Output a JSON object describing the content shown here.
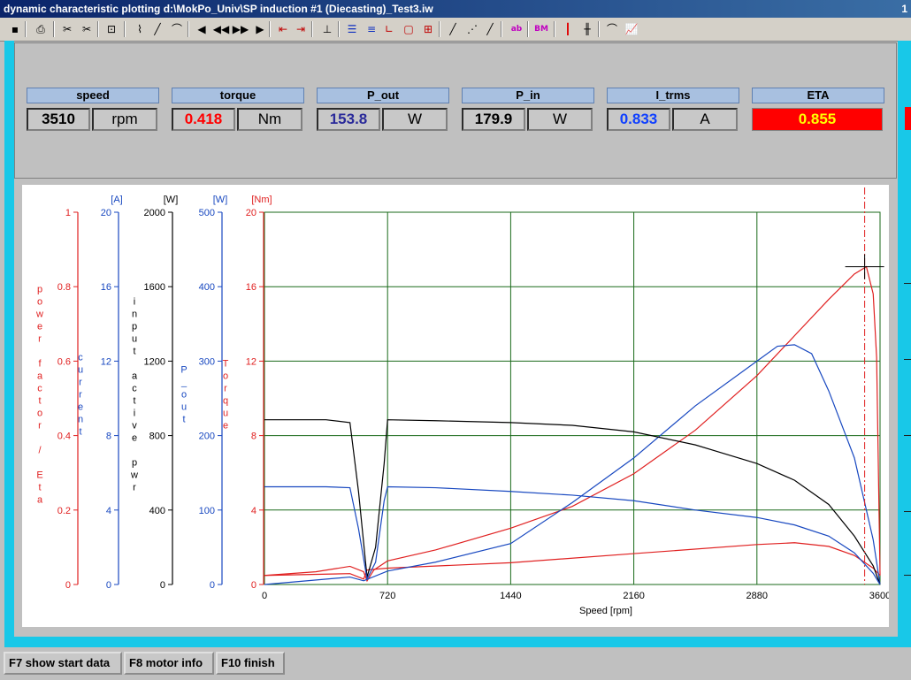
{
  "window": {
    "title": "dynamic characteristic plotting  d:\\MokPo_Univ\\SP induction #1 (Diecasting)_Test3.iw",
    "title_right": "1"
  },
  "toolbar": {
    "buttons": [
      {
        "icon": "save-icon",
        "glyph": "▪"
      },
      {
        "icon": "print-icon",
        "glyph": "⎙"
      },
      {
        "icon": "cut-select-icon",
        "glyph": "✂"
      },
      {
        "icon": "scissors-icon",
        "glyph": "✂"
      },
      {
        "icon": "lock-icon",
        "glyph": "⊡"
      },
      {
        "icon": "curve-tool-1-icon",
        "glyph": "⌇"
      },
      {
        "icon": "curve-tool-2-icon",
        "glyph": "╱"
      },
      {
        "icon": "curve-tool-3-icon",
        "glyph": "⌒"
      },
      {
        "icon": "first-icon",
        "glyph": "◀"
      },
      {
        "icon": "rewind-icon",
        "glyph": "◀◀"
      },
      {
        "icon": "forward-icon",
        "glyph": "▶▶"
      },
      {
        "icon": "last-icon",
        "glyph": "▶"
      },
      {
        "icon": "range-start-icon",
        "glyph": "⇤"
      },
      {
        "icon": "range-end-icon",
        "glyph": "⇥"
      },
      {
        "icon": "marker-icon",
        "glyph": "⊥"
      },
      {
        "icon": "list-icon",
        "glyph": "☰"
      },
      {
        "icon": "axis-value-icon",
        "glyph": "≡"
      },
      {
        "icon": "frame-l-icon",
        "glyph": "∟"
      },
      {
        "icon": "frame-box-icon",
        "glyph": "▢"
      },
      {
        "icon": "grid-icon",
        "glyph": "⊞"
      },
      {
        "icon": "line-solid-icon",
        "glyph": "╱"
      },
      {
        "icon": "line-dotted-icon",
        "glyph": "⋰"
      },
      {
        "icon": "line-dashed-icon",
        "glyph": "╱"
      },
      {
        "icon": "text-label-icon",
        "glyph": "ab"
      },
      {
        "icon": "bitmap-icon",
        "glyph": "BM"
      },
      {
        "icon": "red-bar-icon",
        "glyph": "┃"
      },
      {
        "icon": "double-bar-icon",
        "glyph": "╫"
      },
      {
        "icon": "load-curve-icon",
        "glyph": "⌒"
      },
      {
        "icon": "chart-icon",
        "glyph": "📈"
      }
    ]
  },
  "meters": [
    {
      "label": "speed",
      "value": "3510",
      "unit": "rpm",
      "value_color": "#000000"
    },
    {
      "label": "torque",
      "value": "0.418",
      "unit": "Nm",
      "value_color": "#ff0000"
    },
    {
      "label": "P_out",
      "value": "153.8",
      "unit": "W",
      "value_color": "#2a2a9a"
    },
    {
      "label": "P_in",
      "value": "179.9",
      "unit": "W",
      "value_color": "#000000"
    },
    {
      "label": "I_trms",
      "value": "0.833",
      "unit": "A",
      "value_color": "#1040ff"
    },
    {
      "label": "ETA",
      "value": "0.855",
      "unit": "",
      "value_color": "#ffff00",
      "background": "#ff0000"
    }
  ],
  "footer": {
    "f7": "F7 show start data",
    "f8": "F8 motor info",
    "f10": "F10 finish"
  },
  "chart_data": {
    "type": "line",
    "xlabel": "Speed [rpm]",
    "x_ticks": [
      0,
      720,
      1440,
      2160,
      2880,
      3600
    ],
    "xlim": [
      0,
      3600
    ],
    "grid": true,
    "marker_speed": 3510,
    "axes": [
      {
        "label": "power factor / Eta",
        "unit": "",
        "ticks": [
          "1",
          "0.8",
          "0.6",
          "0.4",
          "0.2",
          "0"
        ],
        "range": [
          0,
          1
        ],
        "color": "#e02020"
      },
      {
        "label": "current",
        "unit": "[A]",
        "ticks": [
          "20",
          "16",
          "12",
          "8",
          "4",
          "0"
        ],
        "range": [
          0,
          20
        ],
        "color": "#1848c0"
      },
      {
        "label": "input active pwr",
        "unit": "[W]",
        "ticks": [
          "2000",
          "1600",
          "1200",
          "800",
          "400",
          "0"
        ],
        "range": [
          0,
          2000
        ],
        "color": "#000000"
      },
      {
        "label": "P_out",
        "unit": "[W]",
        "ticks": [
          "500",
          "400",
          "300",
          "200",
          "100",
          "0"
        ],
        "range": [
          0,
          500
        ],
        "color": "#1848c0"
      },
      {
        "label": "Torque",
        "unit": "[Nm]",
        "ticks": [
          "20",
          "16",
          "12",
          "8",
          "4",
          "0"
        ],
        "range": [
          -0.5,
          20
        ],
        "color": "#e02020"
      }
    ],
    "series": [
      {
        "axis": 4,
        "color": "#e02020",
        "x": [
          0,
          300,
          500,
          580,
          600,
          640,
          720,
          1000,
          1440,
          1800,
          2160,
          2520,
          2880,
          3100,
          3300,
          3450,
          3520,
          3560,
          3580,
          3600
        ],
        "values": [
          0,
          0.2,
          0.5,
          0.2,
          -0.3,
          0.3,
          0.8,
          1.4,
          2.6,
          3.8,
          5.6,
          8.0,
          11.0,
          13.2,
          15.2,
          16.6,
          17.0,
          15.5,
          12.0,
          0
        ]
      },
      {
        "axis": 4,
        "color": "#e02020",
        "x": [
          0,
          500,
          580,
          600,
          720,
          1440,
          2160,
          2880,
          3100,
          3300,
          3450,
          3560,
          3600
        ],
        "values": [
          0,
          0.1,
          -0.2,
          0.3,
          0.4,
          0.7,
          1.2,
          1.7,
          1.8,
          1.6,
          1.1,
          0.4,
          0
        ]
      },
      {
        "axis": 3,
        "color": "#1848c0",
        "x": [
          0,
          500,
          580,
          720,
          1000,
          1440,
          1800,
          2160,
          2520,
          2880,
          3000,
          3100,
          3200,
          3300,
          3450,
          3560,
          3600
        ],
        "values": [
          0,
          10,
          5,
          18,
          30,
          55,
          110,
          170,
          240,
          300,
          320,
          322,
          310,
          260,
          170,
          60,
          0
        ]
      },
      {
        "axis": 2,
        "color": "#000000",
        "x": [
          0,
          360,
          500,
          550,
          600,
          650,
          700,
          720,
          1000,
          1440,
          1800,
          2160,
          2520,
          2880,
          3100,
          3300,
          3450,
          3560,
          3600
        ],
        "values": [
          885,
          885,
          870,
          500,
          40,
          200,
          650,
          885,
          880,
          870,
          855,
          820,
          750,
          650,
          560,
          430,
          260,
          100,
          0
        ]
      },
      {
        "axis": 1,
        "color": "#1848c0",
        "x": [
          0,
          360,
          500,
          550,
          600,
          650,
          700,
          720,
          1000,
          1440,
          1800,
          2160,
          2520,
          2880,
          3100,
          3300,
          3450,
          3560,
          3600
        ],
        "values": [
          5.25,
          5.25,
          5.2,
          3.0,
          0.3,
          1.2,
          4.5,
          5.25,
          5.2,
          5.0,
          4.8,
          4.5,
          4.0,
          3.6,
          3.2,
          2.6,
          1.7,
          0.6,
          0
        ]
      }
    ]
  }
}
